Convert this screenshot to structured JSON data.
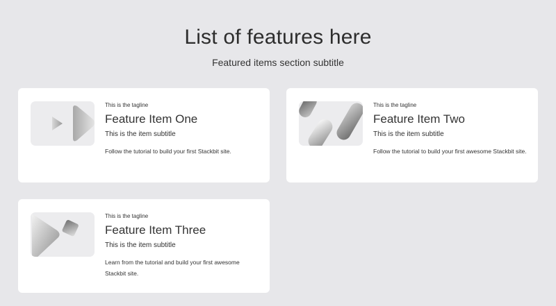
{
  "section": {
    "title": "List of features here",
    "subtitle": "Featured items section subtitle"
  },
  "features": [
    {
      "tagline": "This is the tagline",
      "title": "Feature Item One",
      "subtitle": "This is the item subtitle",
      "text": "Follow the tutorial to build your first Stackbit site.",
      "icon": "play-shapes-icon"
    },
    {
      "tagline": "This is the tagline",
      "title": "Feature Item Two",
      "subtitle": "This is the item subtitle",
      "text": "Follow the tutorial to build your first awesome Stackbit site.",
      "icon": "slanted-pills-icon"
    },
    {
      "tagline": "This is the tagline",
      "title": "Feature Item Three",
      "subtitle": "This is the item subtitle",
      "text": "Learn from the tutorial and build your first awesome Stackbit site.",
      "icon": "triangle-cube-icon"
    }
  ],
  "colors": {
    "page_background": "#e7e7ea",
    "card_background": "#ffffff",
    "thumb_background": "#ececee",
    "text": "#333333"
  }
}
